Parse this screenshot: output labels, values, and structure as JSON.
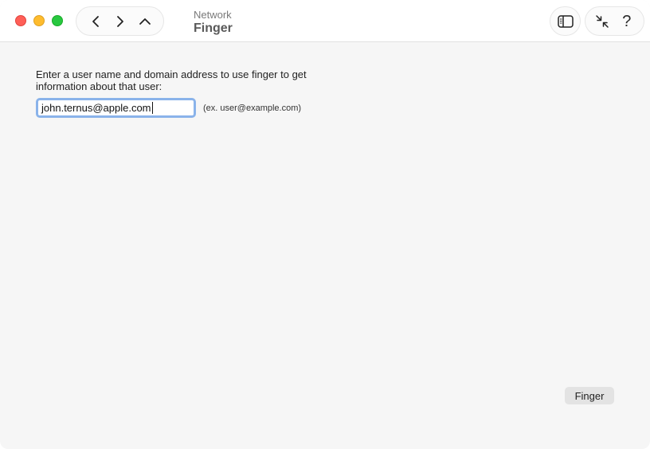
{
  "window": {
    "title_sub": "Network",
    "title_main": "Finger"
  },
  "toolbar": {
    "nav": [
      "back-icon",
      "forward-icon",
      "up-icon"
    ],
    "sidebar_icon": "sidebar-toggle-icon",
    "collapse_icon": "collapse-arrows-icon",
    "help_label": "?"
  },
  "main": {
    "prompt": "Enter a user name and domain address to use finger to get information about that user:",
    "address_value": "john.ternus@apple.com",
    "address_hint": "(ex. user@example.com)",
    "finger_button": "Finger"
  },
  "colors": {
    "close": "#ff5f57",
    "minimize": "#febc2e",
    "zoom": "#28c840",
    "focus_ring": "#8ab3ea"
  }
}
